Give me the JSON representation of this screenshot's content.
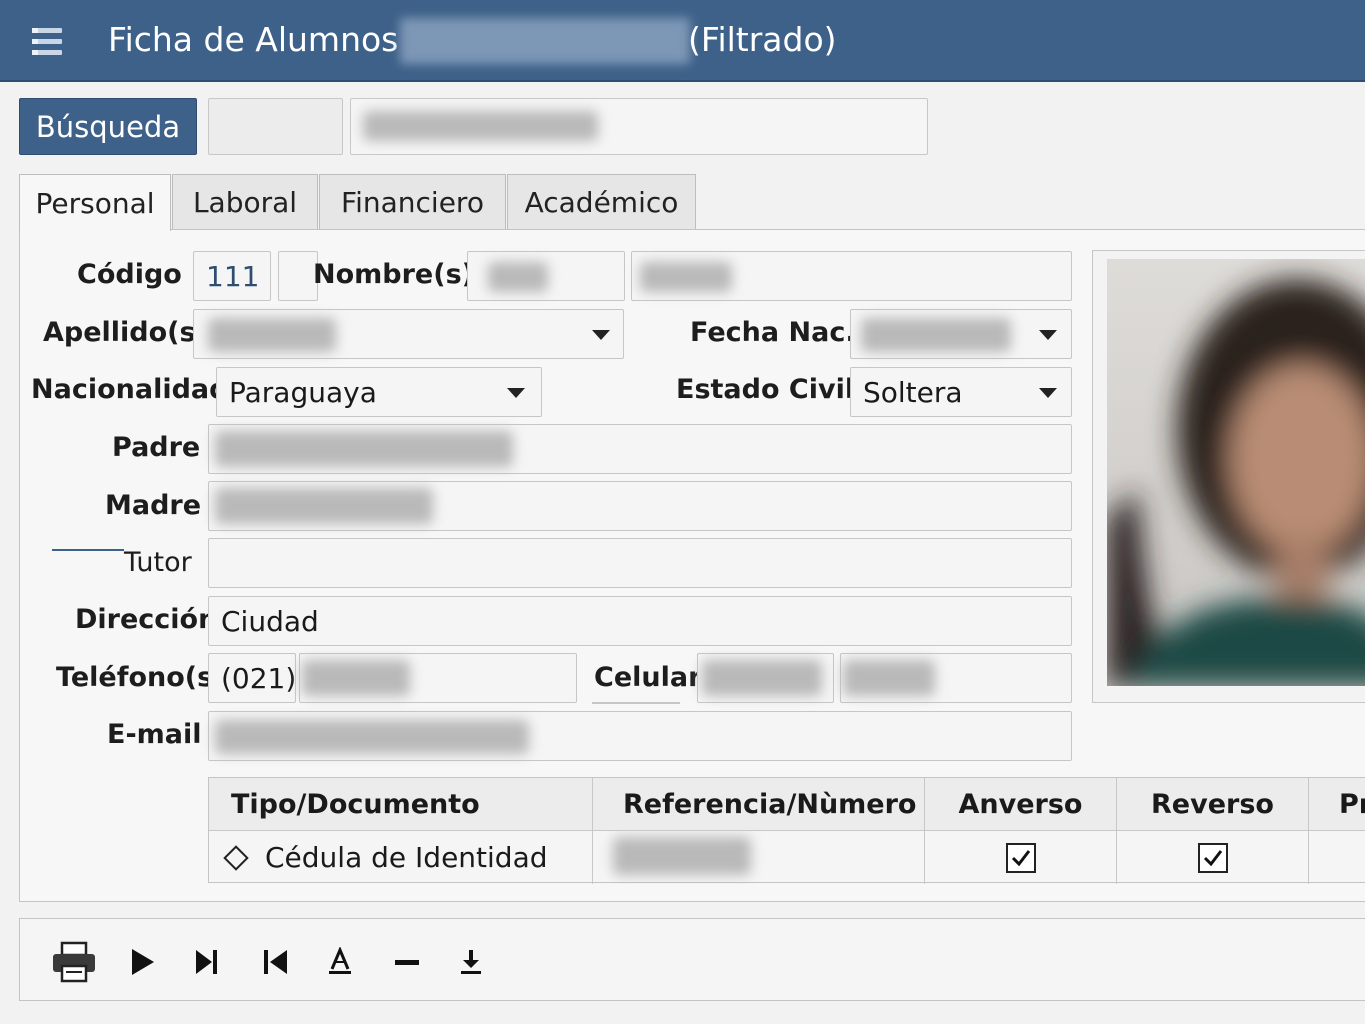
{
  "window": {
    "title_prefix": "Ficha de Alumnos -",
    "title_suffix": "(Filtrado)"
  },
  "search": {
    "button_label": "Búsqueda"
  },
  "tabs": [
    {
      "label": "Personal",
      "active": true
    },
    {
      "label": "Laboral"
    },
    {
      "label": "Financiero"
    },
    {
      "label": "Académico"
    }
  ],
  "form": {
    "codigo": {
      "label": "Código",
      "value": "111"
    },
    "nombre": {
      "label": "Nombre(s)"
    },
    "apellido": {
      "label": "Apellido(s)"
    },
    "fecha_nac": {
      "label": "Fecha Nac."
    },
    "nacionalidad": {
      "label": "Nacionalidad",
      "value": "Paraguaya"
    },
    "estado_civil": {
      "label": "Estado Civil",
      "value": "Soltera"
    },
    "padre": {
      "label": "Padre"
    },
    "madre": {
      "label": "Madre"
    },
    "tutor": {
      "label": "Tutor",
      "value": ""
    },
    "direccion": {
      "label": "Dirección",
      "value": "Ciudad"
    },
    "telefono": {
      "label": "Teléfono(s)",
      "area_code": "(021)"
    },
    "celular": {
      "label": "Celular"
    },
    "email": {
      "label": "E-mail"
    }
  },
  "documents": {
    "columns": [
      "Tipo/Documento",
      "Referencia/Nùmero",
      "Anverso",
      "Reverso",
      "Pr"
    ],
    "rows": [
      {
        "tipo": "Cédula de Identidad",
        "anverso": true,
        "reverso": true
      }
    ]
  },
  "toolbar": {
    "icons": [
      "printer-icon",
      "play-icon",
      "next-end-icon",
      "first-icon",
      "edit-icon",
      "minus-icon",
      "download-icon"
    ]
  },
  "colors": {
    "accent": "#3e6189"
  }
}
